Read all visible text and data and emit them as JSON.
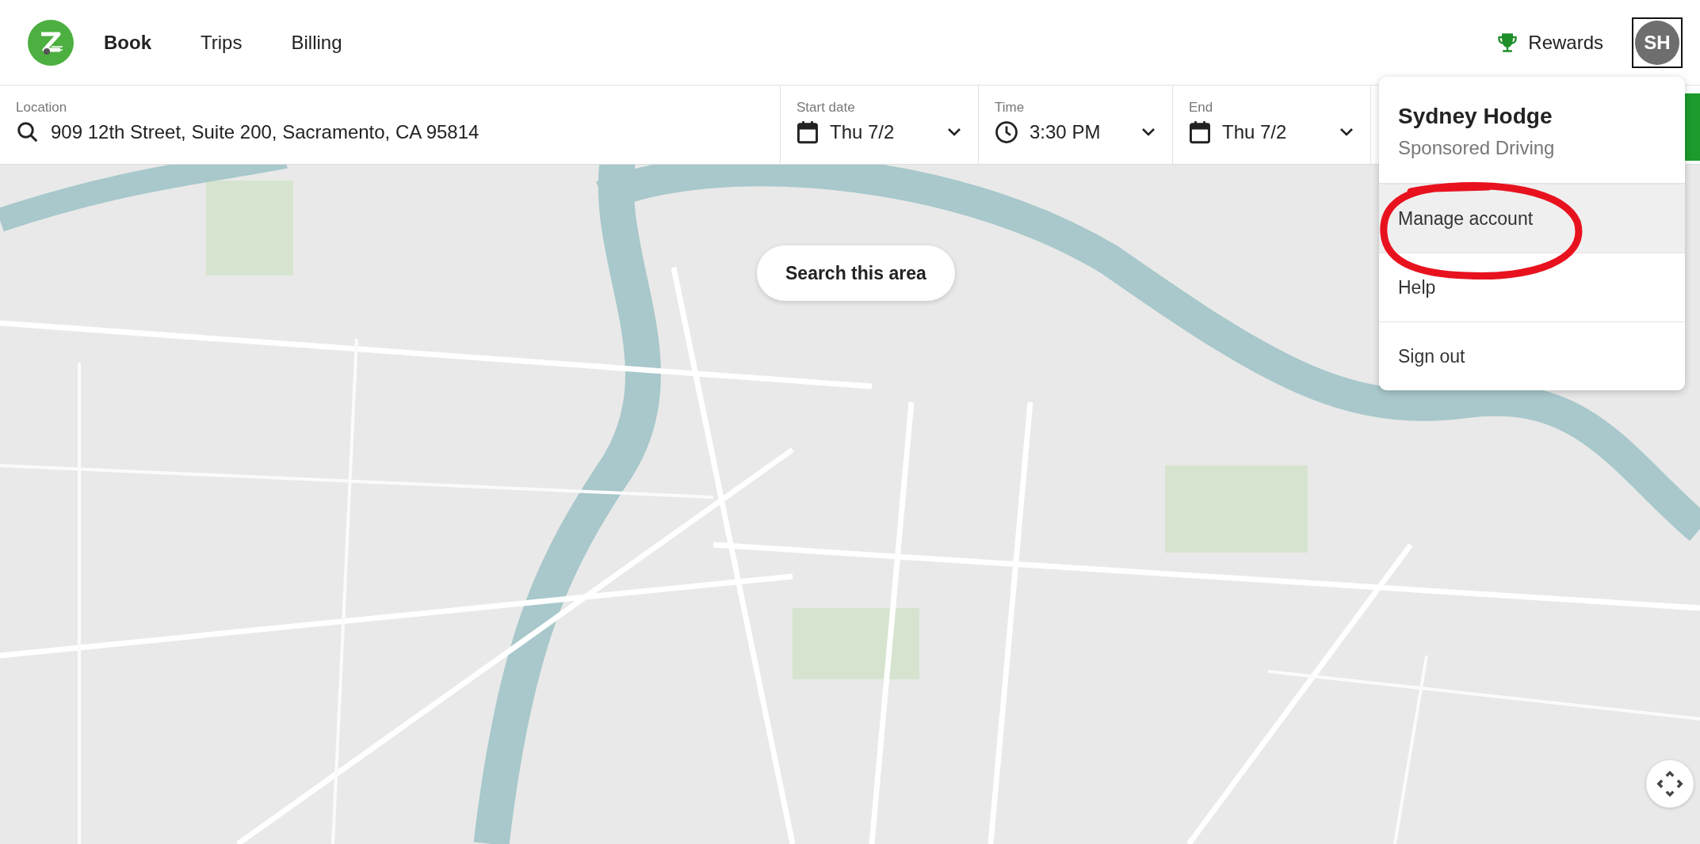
{
  "header": {
    "nav": [
      {
        "label": "Book",
        "selected": true
      },
      {
        "label": "Trips",
        "selected": false
      },
      {
        "label": "Billing",
        "selected": false
      }
    ],
    "rewards": "Rewards",
    "avatar": "SH"
  },
  "search_bar": {
    "fields": [
      {
        "kind": "location",
        "label": "Location",
        "value": "909 12th Street, Suite 200, Sacramento, CA 95814"
      },
      {
        "kind": "date",
        "label": "Start date",
        "value": "Thu 7/2"
      },
      {
        "kind": "time",
        "label": "Time",
        "value": "3:30 PM"
      },
      {
        "kind": "date",
        "label": "End",
        "value": "Thu 7/2"
      }
    ]
  },
  "map": {
    "kind": "picture",
    "search_button": "Search this area"
  },
  "account_menu": {
    "name": "Sydney Hodge",
    "subtitle": "Sponsored Driving",
    "items": [
      {
        "label": "Manage account",
        "selected": true
      },
      {
        "label": "Help",
        "selected": false
      },
      {
        "label": "Sign out",
        "selected": false
      }
    ]
  },
  "annotation": {
    "kind": "ellipse"
  }
}
